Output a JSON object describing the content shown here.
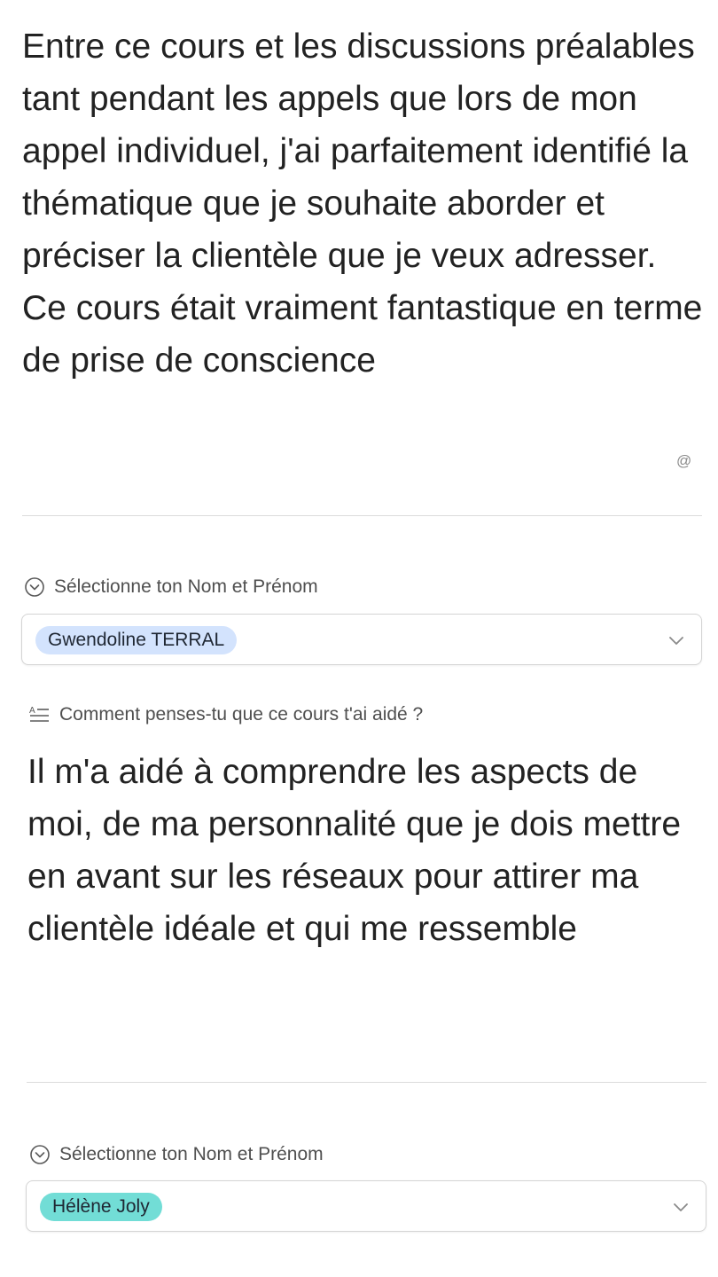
{
  "record_1": {
    "answer_text": "Entre ce cours et les discussions préalables tant pendant les appels que lors de mon appel individuel, j'ai parfaitement identifié la thématique que je souhaite aborder et préciser la clientèle que je veux adresser. Ce cours était vraiment fantastique en terme de prise de conscience",
    "mention_icon": "@",
    "name_field": {
      "label": "Sélectionne ton Nom et Prénom",
      "icon": "circle-chevron-down-icon",
      "selected": "Gwendoline TERRAL",
      "chip_color": "#d3e3fd"
    }
  },
  "record_2": {
    "question_label": "Comment penses-tu que ce cours t'ai aidé ?",
    "question_icon": "long-text-icon",
    "answer_text": "Il m'a aidé à comprendre les aspects de moi, de ma personnalité que je dois mettre en avant sur les réseaux pour attirer ma clientèle idéale et qui me ressemble",
    "name_field": {
      "label": "Sélectionne ton Nom et Prénom",
      "icon": "circle-chevron-down-icon",
      "selected": "Hélène Joly",
      "chip_color": "#72ddd6"
    }
  }
}
